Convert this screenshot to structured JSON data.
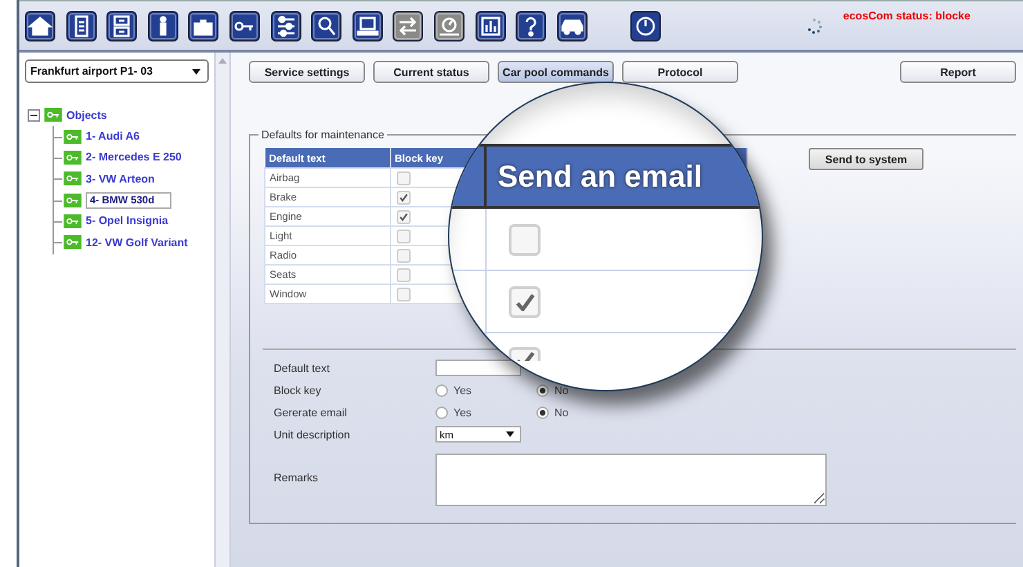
{
  "toolbar": {
    "status": "ecosCom status: blocke"
  },
  "location_select": {
    "value": "Frankfurt airport P1- 03"
  },
  "tree": {
    "label": "Objects",
    "expanded": true,
    "children": [
      {
        "label": "1- Audi A6",
        "selected": false
      },
      {
        "label": "2- Mercedes E 250",
        "selected": false
      },
      {
        "label": "3- VW Arteon",
        "selected": false
      },
      {
        "label": "4- BMW 530d",
        "selected": true
      },
      {
        "label": "5- Opel Insignia",
        "selected": false
      },
      {
        "label": "12- VW Golf Variant",
        "selected": false
      }
    ]
  },
  "tabs": [
    {
      "label": "Service settings",
      "selected": false
    },
    {
      "label": "Current status",
      "selected": false
    },
    {
      "label": "Car pool commands",
      "selected": true
    },
    {
      "label": "Protocol",
      "selected": false
    }
  ],
  "report_button": "Report",
  "maintenance": {
    "title": "Defaults for maintenance",
    "columns": [
      "Default text",
      "Block key"
    ],
    "rows": [
      {
        "text": "Airbag",
        "block_key": false
      },
      {
        "text": "Brake",
        "block_key": true
      },
      {
        "text": "Engine",
        "block_key": true
      },
      {
        "text": "Light",
        "block_key": false
      },
      {
        "text": "Radio",
        "block_key": false
      },
      {
        "text": "Seats",
        "block_key": false
      },
      {
        "text": "Window",
        "block_key": false
      }
    ],
    "send_button": "Send to system"
  },
  "form": [
    {
      "kind": "text",
      "label": "Default text"
    },
    {
      "kind": "radio",
      "label": "Block key",
      "options": [
        {
          "label": "Yes",
          "selected": false
        },
        {
          "label": "No",
          "selected": true
        }
      ]
    },
    {
      "kind": "radio",
      "label": "Gererate email",
      "options": [
        {
          "label": "Yes",
          "selected": false
        },
        {
          "label": "No",
          "selected": true
        }
      ]
    },
    {
      "kind": "select",
      "label": "Unit description",
      "value": "km"
    },
    {
      "kind": "textarea",
      "label": "Remarks"
    }
  ],
  "magnifier": {
    "header": "Send an email",
    "rows": [
      {
        "checked": false
      },
      {
        "checked": true
      },
      {
        "checked": true
      }
    ]
  }
}
